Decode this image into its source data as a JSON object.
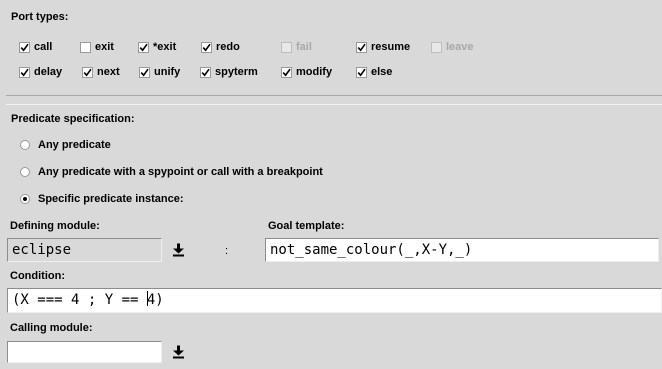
{
  "port_types": {
    "heading": "Port types:",
    "row1": [
      {
        "label": "call",
        "checked": true,
        "enabled": true
      },
      {
        "label": "exit",
        "checked": false,
        "enabled": true
      },
      {
        "label": "*exit",
        "checked": true,
        "enabled": true
      },
      {
        "label": "redo",
        "checked": true,
        "enabled": true
      },
      {
        "label": "fail",
        "checked": false,
        "enabled": false
      },
      {
        "label": "resume",
        "checked": true,
        "enabled": true
      },
      {
        "label": "leave",
        "checked": false,
        "enabled": false
      }
    ],
    "row2": [
      {
        "label": "delay",
        "checked": true,
        "enabled": true
      },
      {
        "label": "next",
        "checked": true,
        "enabled": true
      },
      {
        "label": "unify",
        "checked": true,
        "enabled": true
      },
      {
        "label": "spyterm",
        "checked": true,
        "enabled": true
      },
      {
        "label": "modify",
        "checked": true,
        "enabled": true
      },
      {
        "label": "else",
        "checked": true,
        "enabled": true
      }
    ]
  },
  "predicate_spec": {
    "heading": "Predicate specification:",
    "options": [
      {
        "label": "Any predicate",
        "selected": false
      },
      {
        "label": "Any predicate with a spypoint or call with a breakpoint",
        "selected": false
      },
      {
        "label": "Specific predicate instance:",
        "selected": true
      }
    ]
  },
  "defining_module": {
    "label": "Defining module:",
    "value": "eclipse"
  },
  "separator": ":",
  "goal_template": {
    "label": "Goal template:",
    "value": "not_same_colour(_,X-Y,_)"
  },
  "condition": {
    "label": "Condition:",
    "value_before_cursor": "(X === 4 ; Y == ",
    "value_after_cursor": "4)"
  },
  "calling_module": {
    "label": "Calling module:",
    "value": ""
  }
}
